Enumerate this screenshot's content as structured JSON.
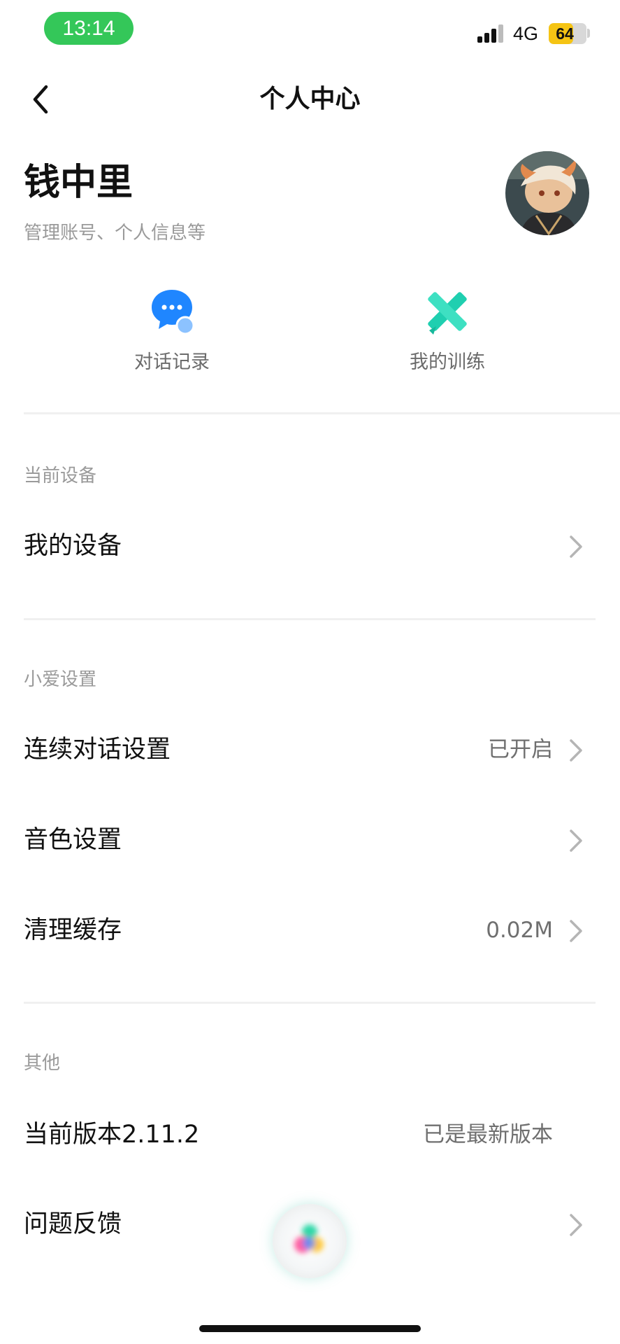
{
  "status_bar": {
    "time": "13:14",
    "network": "4G",
    "battery_level": "64",
    "battery_fraction": 0.64
  },
  "nav": {
    "title": "个人中心"
  },
  "profile": {
    "name": "钱中里",
    "subtitle": "管理账号、个人信息等"
  },
  "shortcuts": [
    {
      "label": "对话记录",
      "icon": "chat-bubble-icon"
    },
    {
      "label": "我的训练",
      "icon": "training-cross-icon"
    }
  ],
  "sections": {
    "device": {
      "title": "当前设备",
      "rows": [
        {
          "label": "我的设备",
          "value": ""
        }
      ]
    },
    "xiaoai": {
      "title": "小爱设置",
      "rows": [
        {
          "label": "连续对话设置",
          "value": "已开启"
        },
        {
          "label": "音色设置",
          "value": ""
        },
        {
          "label": "清理缓存",
          "value": "0.02M"
        }
      ]
    },
    "other": {
      "title": "其他",
      "rows": [
        {
          "label": "当前版本2.11.2",
          "value": "已是最新版本"
        },
        {
          "label": "问题反馈",
          "value": ""
        }
      ]
    }
  },
  "colors": {
    "accent_green": "#34c759",
    "chat_blue": "#1f86ff",
    "training_teal": "#1fcfb0",
    "battery_yellow": "#f5c414"
  }
}
